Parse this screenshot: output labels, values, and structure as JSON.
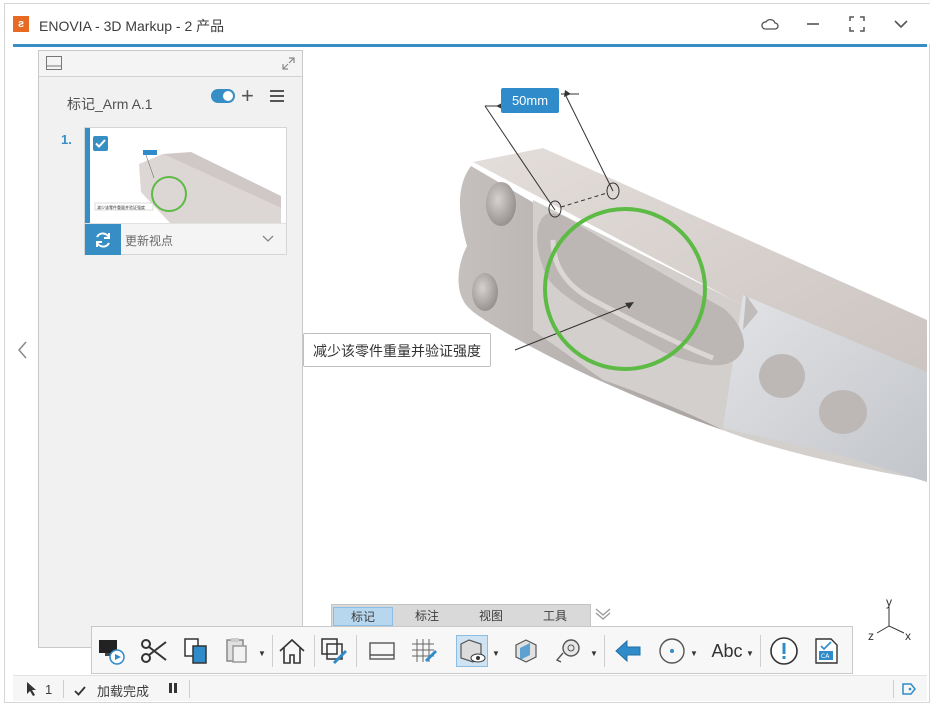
{
  "window": {
    "app_title": "ENOVIA - 3D Markup - 2 产品",
    "logo": "3ds-logo"
  },
  "panel": {
    "markup_title": "标记_Arm A.1",
    "items": [
      {
        "number": "1.",
        "checked": true,
        "thumbnail_caption": "减少该零件重量并验证强度",
        "thumbnail_dim": "50mm",
        "action_label": "更新视点"
      }
    ]
  },
  "viewport": {
    "callout_text": "减少该零件重量并验证强度",
    "dimension_label": "50mm",
    "highlight_color": "#5dbb45",
    "dimension_color": "#2f8bc9",
    "axis_labels": {
      "x": "x",
      "y": "y",
      "z": "z"
    }
  },
  "tabs": [
    {
      "label": "标记",
      "active": true
    },
    {
      "label": "标注",
      "active": false
    },
    {
      "label": "视图",
      "active": false
    },
    {
      "label": "工具",
      "active": false
    }
  ],
  "toolbar": {
    "tools": [
      "capture-video-icon",
      "scissors-icon",
      "copy-icon",
      "paste-icon",
      "home-icon",
      "edit-markup-icon",
      "panel-icon",
      "grid-edit-icon",
      "view-mode-icon",
      "section-icon",
      "measure-icon",
      "back-arrow-icon",
      "target-icon",
      "text-style-icon",
      "alert-icon",
      "certificate-icon"
    ],
    "text_style_label": "Abc"
  },
  "status": {
    "selection_count": "1",
    "load_status": "加载完成"
  },
  "colors": {
    "accent": "#368ec4",
    "brand_logo": "#e86a22"
  }
}
